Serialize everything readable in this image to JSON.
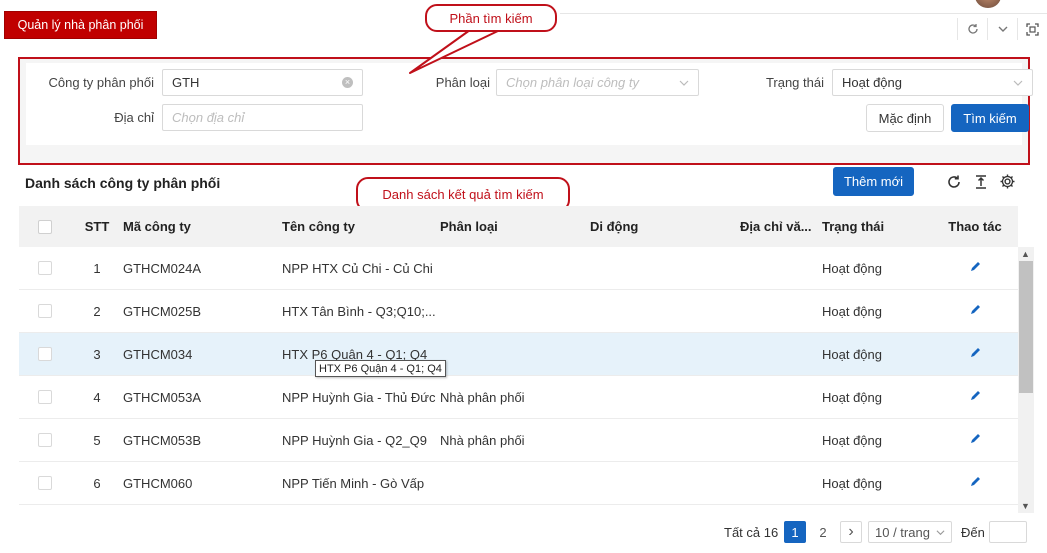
{
  "header": {
    "tab_title": "Quản lý nhà phân phối"
  },
  "annotations": {
    "search_callout": "Phần tìm kiếm",
    "results_callout": "Danh sách kết quả tìm kiếm"
  },
  "search": {
    "company_label": "Công ty phân phối",
    "company_value": "GTH",
    "category_label": "Phân loại",
    "category_placeholder": "Chọn phân loại công ty",
    "status_label": "Trạng thái",
    "status_value": "Hoạt động",
    "address_label": "Địa chỉ",
    "address_placeholder": "Chọn địa chỉ",
    "reset_button": "Mặc định",
    "search_button": "Tìm kiếm"
  },
  "list": {
    "title": "Danh sách công ty phân phối",
    "add_button": "Thêm mới"
  },
  "table": {
    "columns": {
      "stt": "STT",
      "code": "Mã công ty",
      "name": "Tên công ty",
      "category": "Phân loại",
      "mobile": "Di động",
      "address": "Địa chỉ vă...",
      "status": "Trạng thái",
      "actions": "Thao tác"
    },
    "rows": [
      {
        "stt": "1",
        "code": "GTHCM024A",
        "name": "NPP HTX Củ Chi - Củ Chi",
        "category": "",
        "status": "Hoạt động"
      },
      {
        "stt": "2",
        "code": "GTHCM025B",
        "name": "HTX Tân Bình - Q3;Q10;...",
        "category": "",
        "status": "Hoạt động"
      },
      {
        "stt": "3",
        "code": "GTHCM034",
        "name": "HTX P6 Quận 4 - Q1; Q4",
        "category": "",
        "status": "Hoạt động"
      },
      {
        "stt": "4",
        "code": "GTHCM053A",
        "name": "NPP Huỳnh Gia - Thủ Đức",
        "category": "Nhà phân phối",
        "status": "Hoạt động"
      },
      {
        "stt": "5",
        "code": "GTHCM053B",
        "name": "NPP Huỳnh Gia - Q2_Q9",
        "category": "Nhà phân phối",
        "status": "Hoạt động"
      },
      {
        "stt": "6",
        "code": "GTHCM060",
        "name": "NPP Tiến Minh - Gò Vấp",
        "category": "",
        "status": "Hoạt động"
      }
    ],
    "tooltip": "HTX P6 Quận 4 - Q1; Q4"
  },
  "pagination": {
    "total": "Tất cả 16",
    "page1": "1",
    "page2": "2",
    "next": "›",
    "page_size": "10 / trang",
    "goto_label": "Đến"
  },
  "colors": {
    "primary": "#1565c0",
    "brand_red": "#c00000",
    "highlight_row": "#e6f2fa"
  }
}
